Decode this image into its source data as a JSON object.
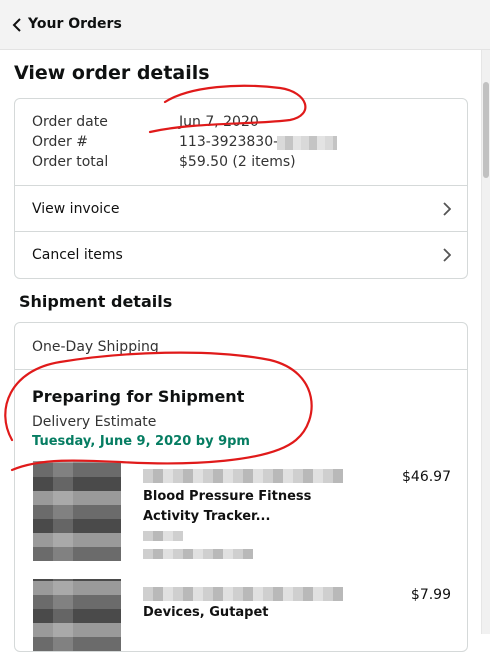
{
  "nav": {
    "back_label": "Your Orders"
  },
  "page": {
    "title": "View order details"
  },
  "order": {
    "date_label": "Order date",
    "date_value": "Jun 7, 2020",
    "number_label": "Order #",
    "number_value": "113-3923830-",
    "total_label": "Order total",
    "total_value": "$59.50 (2 items)",
    "view_invoice": "View invoice",
    "cancel_items": "Cancel items"
  },
  "shipment": {
    "section_title": "Shipment details",
    "method": "One-Day Shipping",
    "status": "Preparing for Shipment",
    "estimate_label": "Delivery Estimate",
    "estimate_value": "Tuesday, June 9, 2020 by 9pm",
    "items": [
      {
        "title_line1": "Blood Pressure Fitness",
        "title_line2": "Activity Tracker...",
        "price": "$46.97"
      },
      {
        "title_line1": "Devices, Gutapet",
        "price": "$7.99"
      }
    ]
  },
  "colors": {
    "accent_green": "#067d62",
    "annotation_red": "#e01a1a"
  },
  "icons": {
    "back": "chevron-left-icon",
    "row": "chevron-right-icon"
  }
}
